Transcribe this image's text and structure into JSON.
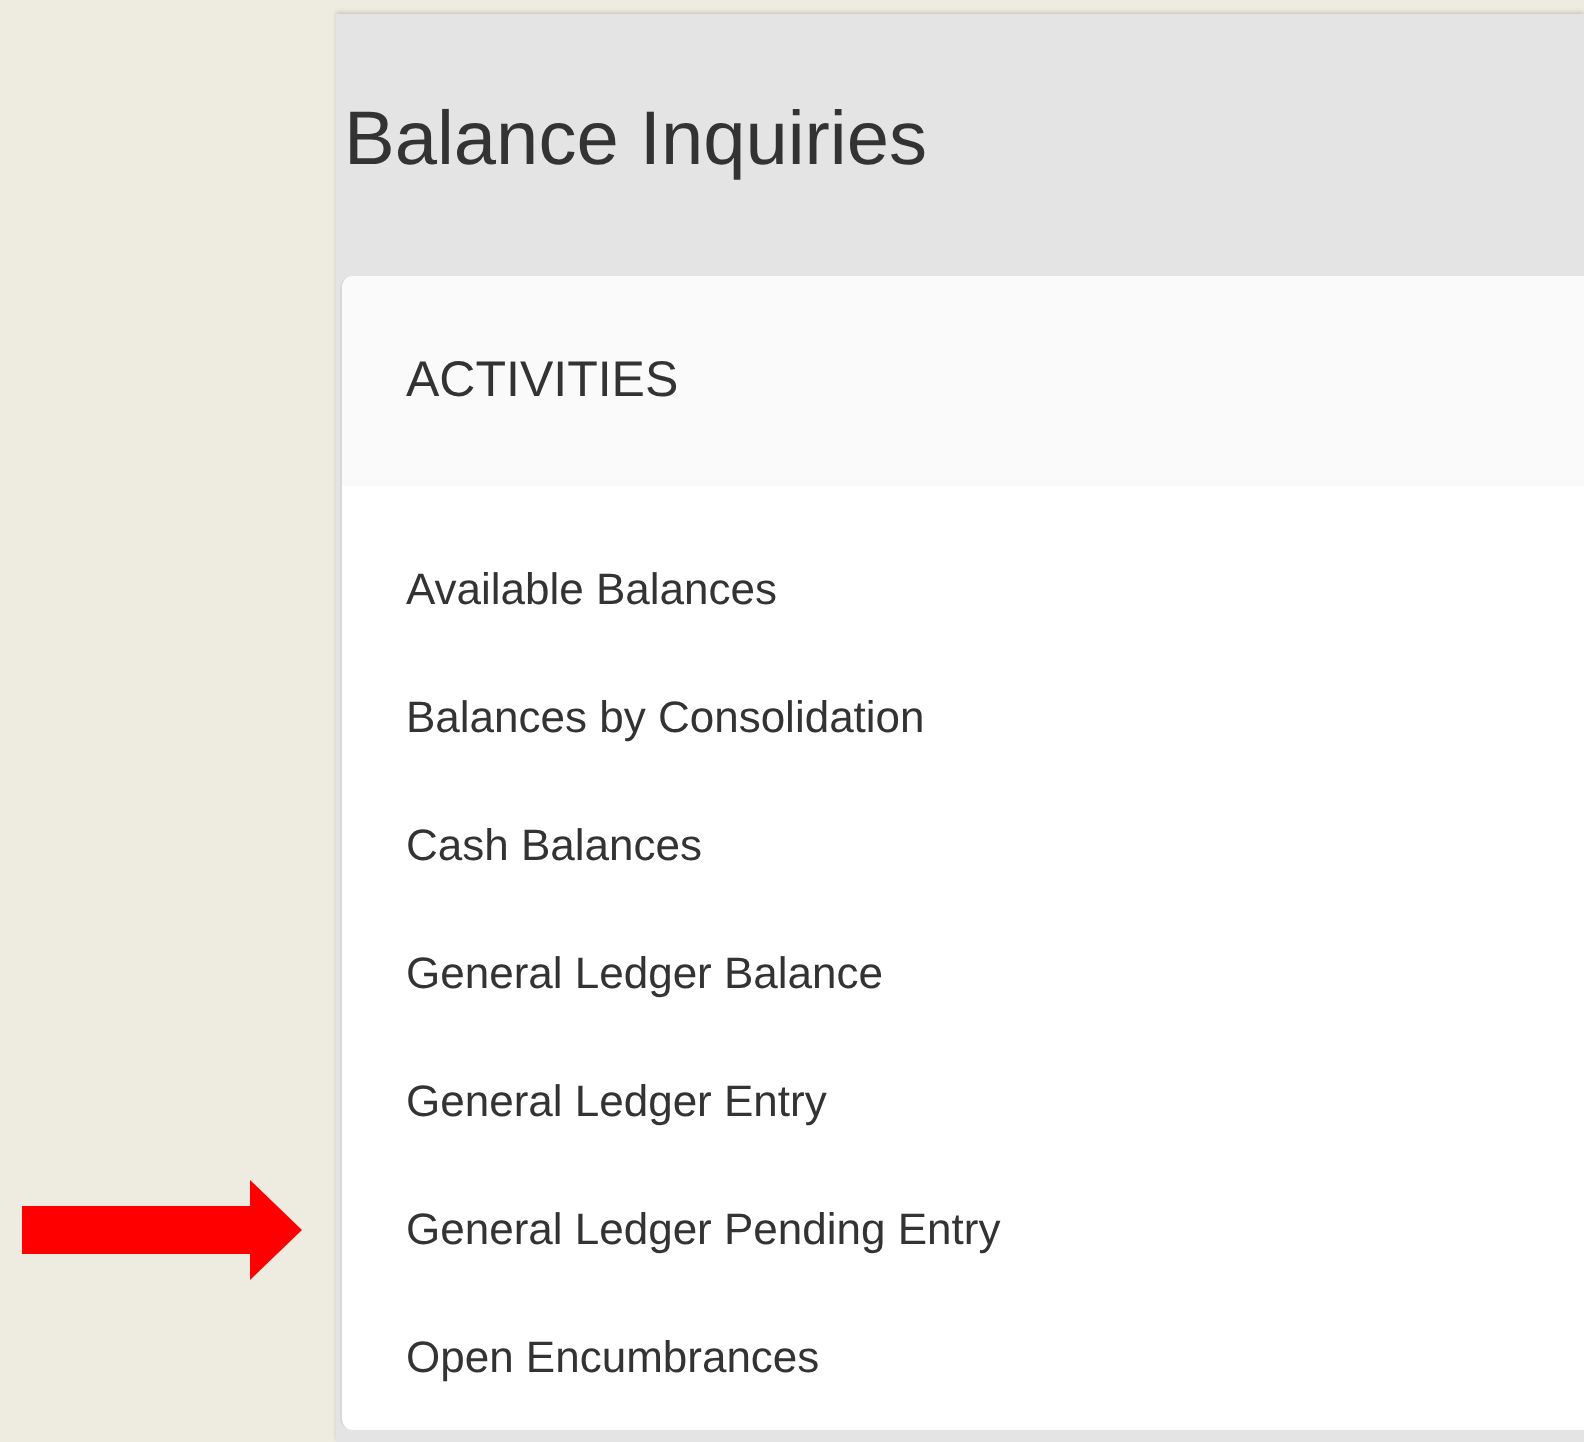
{
  "page": {
    "title": "Balance Inquiries"
  },
  "activities": {
    "heading": "ACTIVITIES",
    "items": [
      {
        "label": "Available Balances",
        "pointed": false
      },
      {
        "label": "Balances by Consolidation",
        "pointed": false
      },
      {
        "label": "Cash Balances",
        "pointed": false
      },
      {
        "label": "General Ledger Balance",
        "pointed": false
      },
      {
        "label": "General Ledger Entry",
        "pointed": false
      },
      {
        "label": "General Ledger Pending Entry",
        "pointed": true
      },
      {
        "label": "Open Encumbrances",
        "pointed": false
      }
    ]
  }
}
